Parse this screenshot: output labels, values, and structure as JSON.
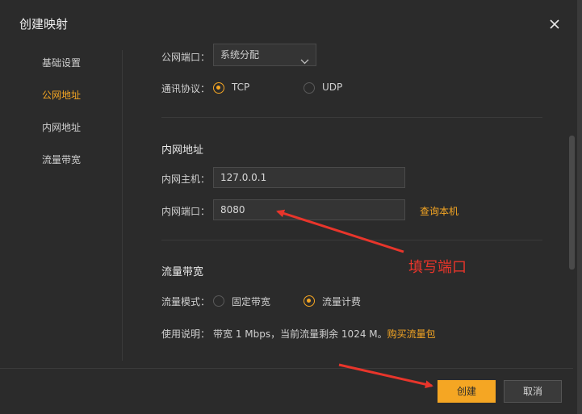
{
  "dialog": {
    "title": "创建映射"
  },
  "sidebar": {
    "items": [
      {
        "label": "基础设置",
        "active": false
      },
      {
        "label": "公网地址",
        "active": true
      },
      {
        "label": "内网地址",
        "active": false
      },
      {
        "label": "流量带宽",
        "active": false
      }
    ]
  },
  "public": {
    "port_label": "公网端口：",
    "port_select_value": "系统分配",
    "protocol_label": "通讯协议：",
    "protocol_options": [
      "TCP",
      "UDP"
    ],
    "protocol_selected": "TCP"
  },
  "internal": {
    "section_title": "内网地址",
    "host_label": "内网主机：",
    "host_value": "127.0.0.1",
    "port_label": "内网端口：",
    "port_value": "8080",
    "query_link": "查询本机"
  },
  "bandwidth": {
    "section_title": "流量带宽",
    "mode_label": "流量模式：",
    "mode_options": [
      "固定带宽",
      "流量计费"
    ],
    "mode_selected": "流量计费",
    "usage_label": "使用说明：",
    "usage_text": "带宽 1 Mbps，当前流量剩余 1024 M。",
    "buy_link": "购买流量包"
  },
  "annotation": {
    "text": "填写端口",
    "color": "#e8352b"
  },
  "footer": {
    "create_label": "创建",
    "cancel_label": "取消"
  },
  "colors": {
    "accent": "#f5a623",
    "background": "#2b2b2b",
    "annotation": "#e8352b"
  }
}
